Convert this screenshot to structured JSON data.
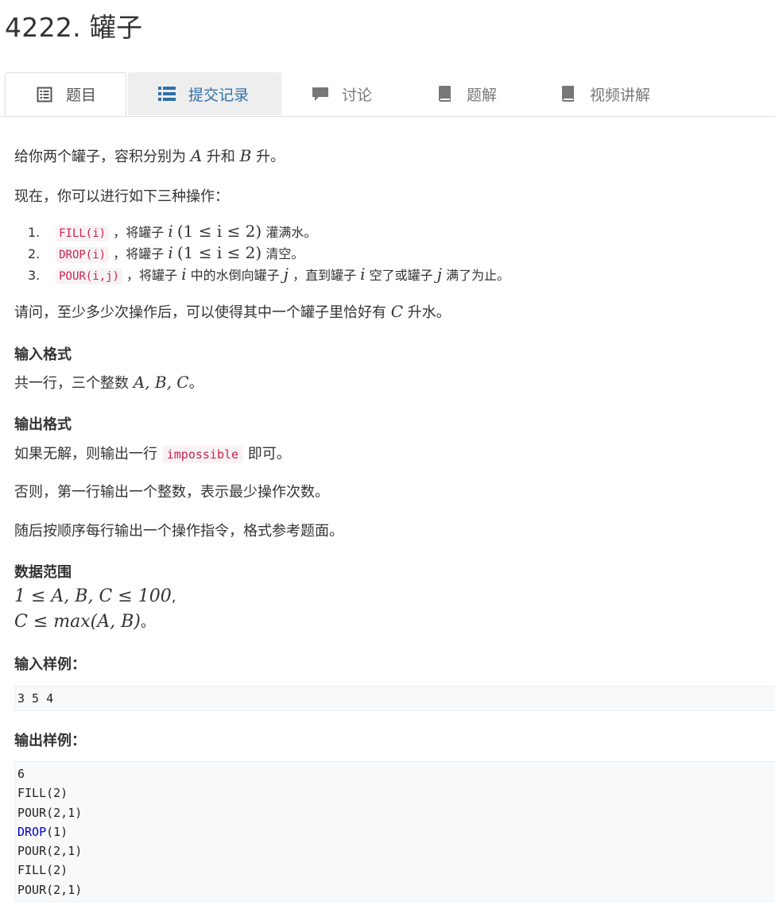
{
  "problem": {
    "title": "4222. 罐子"
  },
  "tabs": [
    {
      "label": "题目",
      "icon": "list-alt-icon"
    },
    {
      "label": "提交记录",
      "icon": "list-icon"
    },
    {
      "label": "讨论",
      "icon": "comment-icon"
    },
    {
      "label": "题解",
      "icon": "book-icon"
    },
    {
      "label": "视频讲解",
      "icon": "book-icon"
    }
  ],
  "description": {
    "intro_pre": "给你两个罐子，容积分别为",
    "var_a": "A",
    "intro_mid": "升和",
    "var_b": "B",
    "intro_post": "升。",
    "ops_intro": "现在，你可以进行如下三种操作：",
    "ops": [
      {
        "num": "1.",
        "code": "FILL(i)",
        "text_a": "，将罐子",
        "var": "i",
        "range": "(1 ≤ i ≤ 2)",
        "text_b": "灌满水。"
      },
      {
        "num": "2.",
        "code": "DROP(i)",
        "text_a": "，将罐子",
        "var": "i",
        "range": "(1 ≤ i ≤ 2)",
        "text_b": "清空。"
      },
      {
        "num": "3.",
        "code": "POUR(i,j)",
        "text_a": "，将罐子",
        "var": "i",
        "text_b": "中的水倒向罐子",
        "var2": "j",
        "text_c": "，直到罐子",
        "var3": "i",
        "text_d": "空了或罐子",
        "var4": "j",
        "text_e": "满了为止。"
      }
    ],
    "question_pre": "请问，至少多少次操作后，可以使得其中一个罐子里恰好有",
    "var_c": "C",
    "question_post": "升水。"
  },
  "input_format": {
    "heading": "输入格式",
    "text_pre": "共一行，三个整数",
    "vars": "A, B, C",
    "text_post": "。"
  },
  "output_format": {
    "heading": "输出格式",
    "line1_pre": "如果无解，则输出一行",
    "line1_code": "impossible",
    "line1_post": "即可。",
    "line2": "否则，第一行输出一个整数，表示最少操作次数。",
    "line3": "随后按顺序每行输出一个操作指令，格式参考题面。"
  },
  "constraints": {
    "heading": "数据范围",
    "line1": "1 ≤ A, B, C ≤ 100",
    "line1_suffix": ",",
    "line2": "C ≤ max(A, B)",
    "line2_suffix": "。"
  },
  "sample_input": {
    "heading": "输入样例：",
    "content": "3 5 4"
  },
  "sample_output": {
    "heading": "输出样例：",
    "lines": [
      "6",
      "FILL(2)",
      "POUR(2,1)",
      "DROP(1)",
      "POUR(2,1)",
      "FILL(2)",
      "POUR(2,1)"
    ],
    "highlight_keyword": "DROP",
    "keyword_color": "#0000cc"
  },
  "colors": {
    "code_fg": "#c7254e",
    "code_bg": "#f9f2f4",
    "link": "#3071a9"
  }
}
